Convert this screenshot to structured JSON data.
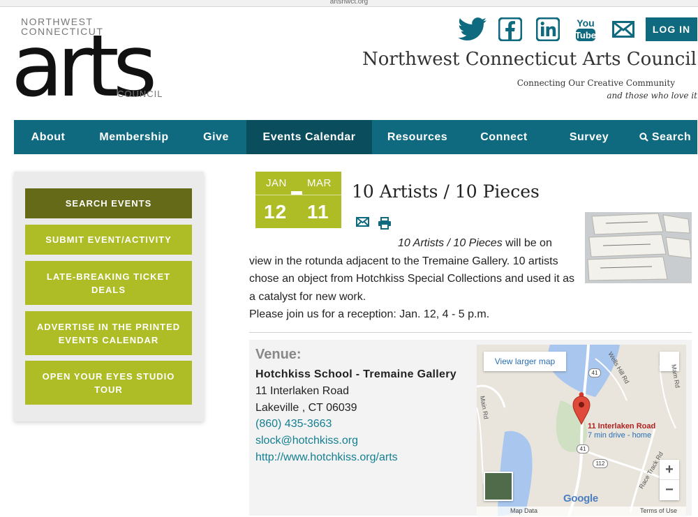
{
  "browser": {
    "url": "artsnwct.org"
  },
  "logo": {
    "top_text": "NORTHWEST CONNECTICUT",
    "big_text": "arts",
    "bottom_text": "COUNCIL"
  },
  "header": {
    "login_label": "LOG IN",
    "site_title": "Northwest Connecticut Arts Council",
    "tagline_line1": "Connecting Our Creative Community",
    "tagline_line2": "and those who love it",
    "social_icons": [
      "twitter-icon",
      "facebook-icon",
      "linkedin-icon",
      "youtube-icon",
      "email-icon"
    ],
    "youtube_line1": "You",
    "youtube_line2": "Tube"
  },
  "nav": {
    "items": [
      {
        "label": "About"
      },
      {
        "label": "Membership"
      },
      {
        "label": "Give"
      },
      {
        "label": "Events Calendar",
        "active": true
      },
      {
        "label": "Resources"
      },
      {
        "label": "Connect"
      },
      {
        "label": "Survey"
      },
      {
        "label": "Search"
      }
    ]
  },
  "sidebar": {
    "buttons": [
      {
        "label": "SEARCH EVENTS"
      },
      {
        "label": "SUBMIT EVENT/ACTIVITY"
      },
      {
        "label": "LATE-BREAKING TICKET DEALS"
      },
      {
        "label": "ADVERTISE IN THE PRINTED EVENTS CALENDAR"
      },
      {
        "label": "OPEN YOUR EYES STUDIO TOUR"
      }
    ]
  },
  "event": {
    "start_month": "JAN",
    "start_day": "12",
    "end_month": "MAR",
    "end_day": "11",
    "title": "10 Artists / 10 Pieces",
    "desc_italic": "10 Artists / 10 Pieces",
    "desc_text": " will be on view in the rotunda adjacent to the Tremaine Gallery. 10 artists chose an object from Hotchkiss Special Collections and used it as a catalyst for new work.",
    "desc_reception": "Please join us for a reception: Jan. 12, 4 - 5 p.m."
  },
  "venue": {
    "label": "Venue:",
    "name": "Hotchkiss School - Tremaine Gallery",
    "street": "11 Interlaken Road",
    "city_state_zip": "Lakeville , CT 06039",
    "phone": "(860) 435-3663",
    "email": "slock@hotchkiss.org",
    "website": "http://www.hotchkiss.org/arts"
  },
  "map": {
    "larger_map_label": "View larger map",
    "marker_title": "11 Interlaken Road",
    "marker_subtitle": "7 min drive - home",
    "zoom_in": "+",
    "zoom_out": "−",
    "brand": "Google",
    "map_data": "Map Data",
    "terms": "Terms of Use",
    "road_labels": [
      "Wells Hill Rd",
      "Main Rd",
      "Race Track Rd",
      "Mam Rd"
    ],
    "shields": [
      "41",
      "41",
      "112"
    ]
  },
  "colors": {
    "nav_bg": "#0f6a7f",
    "nav_active": "#0a4d5c",
    "accent_green": "#aebd26",
    "dark_olive": "#646a17",
    "link": "#137f91"
  }
}
